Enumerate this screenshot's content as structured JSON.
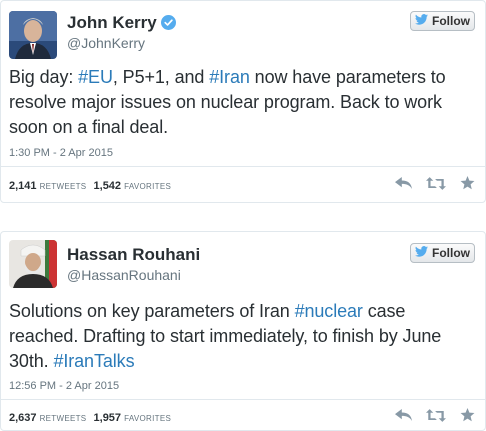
{
  "tweets": [
    {
      "name": "John Kerry",
      "handle": "@JohnKerry",
      "verified": true,
      "follow_label": "Follow",
      "text_parts": [
        "Big day: ",
        "#EU",
        ", P5+1, and ",
        "#Iran",
        " now have parameters to resolve major issues on nuclear program. Back to work soon on a final deal."
      ],
      "timestamp": "1:30 PM - 2 Apr 2015",
      "retweets": "2,141",
      "retweets_label": "RETWEETS",
      "favorites": "1,542",
      "favorites_label": "FAVORITES"
    },
    {
      "name": "Hassan Rouhani",
      "handle": "@HassanRouhani",
      "verified": false,
      "follow_label": "Follow",
      "text_parts": [
        "Solutions on key parameters of Iran ",
        "#nuclear",
        " case reached. Drafting to start immediately, to finish by June 30th. ",
        "#IranTalks"
      ],
      "timestamp": "12:56 PM - 2 Apr 2015",
      "retweets": "2,637",
      "retweets_label": "RETWEETS",
      "favorites": "1,957",
      "favorites_label": "FAVORITES"
    }
  ],
  "icons": {
    "follow": "twitter-bird-icon",
    "verified": "verified-badge-icon",
    "reply": "reply-icon",
    "retweet": "retweet-icon",
    "favorite": "star-icon"
  },
  "colors": {
    "hashtag": "#2b7bb9",
    "verified": "#55acee",
    "bird": "#55acee",
    "action_icon": "#8899a6"
  }
}
